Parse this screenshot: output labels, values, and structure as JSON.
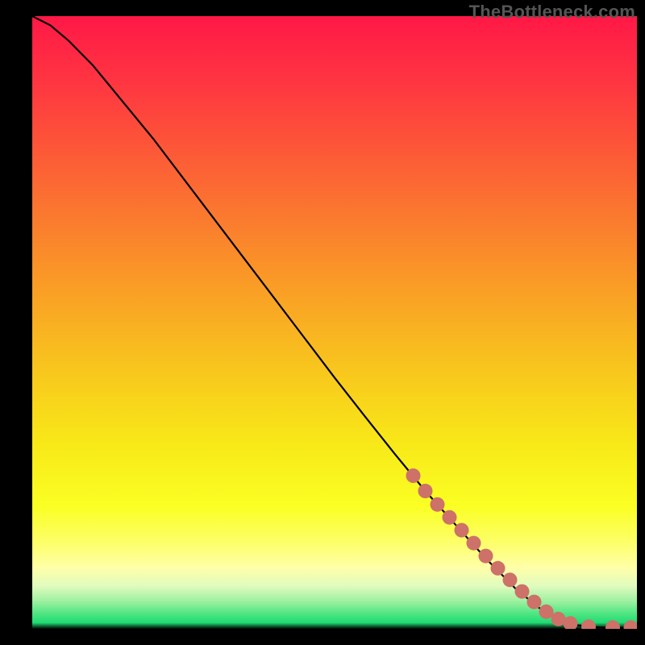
{
  "watermark": "TheBottleneck.com",
  "colors": {
    "background": "#000000",
    "curve": "#000000",
    "marker": "#cd7169",
    "gradient_stops": [
      {
        "offset": 0.0,
        "color": "#ff1846"
      },
      {
        "offset": 0.1,
        "color": "#ff3342"
      },
      {
        "offset": 0.2,
        "color": "#fd5239"
      },
      {
        "offset": 0.3,
        "color": "#fb7131"
      },
      {
        "offset": 0.4,
        "color": "#fa9029"
      },
      {
        "offset": 0.5,
        "color": "#f9af22"
      },
      {
        "offset": 0.6,
        "color": "#f8cd1c"
      },
      {
        "offset": 0.7,
        "color": "#f8e918"
      },
      {
        "offset": 0.8,
        "color": "#faff23"
      },
      {
        "offset": 0.86,
        "color": "#fdff6a"
      },
      {
        "offset": 0.9,
        "color": "#ffffa8"
      },
      {
        "offset": 0.93,
        "color": "#e0fbbe"
      },
      {
        "offset": 0.955,
        "color": "#9df1a0"
      },
      {
        "offset": 0.975,
        "color": "#50e583"
      },
      {
        "offset": 0.99,
        "color": "#1fdc73"
      },
      {
        "offset": 1.0,
        "color": "#000000"
      }
    ]
  },
  "chart_data": {
    "type": "line",
    "title": "",
    "xlabel": "",
    "ylabel": "",
    "xlim": [
      0,
      100
    ],
    "ylim": [
      0,
      100
    ],
    "series": [
      {
        "name": "bottleneck-curve",
        "x": [
          0,
          3,
          6,
          10,
          15,
          20,
          25,
          30,
          35,
          40,
          45,
          50,
          55,
          60,
          65,
          70,
          75,
          80,
          85,
          88,
          90,
          93,
          95,
          97,
          99,
          100
        ],
        "y": [
          100,
          98.5,
          96,
          92,
          86,
          80,
          73.5,
          67,
          60.5,
          54,
          47.5,
          41,
          34.7,
          28.5,
          22.5,
          17,
          11.5,
          6.5,
          2.5,
          1.2,
          0.6,
          0.3,
          0.2,
          0.2,
          0.2,
          0.2
        ]
      }
    ],
    "markers": {
      "name": "highlighted-segment",
      "x": [
        63,
        65,
        67,
        69,
        71,
        73,
        75,
        77,
        79,
        81,
        83,
        85,
        87,
        89,
        92,
        96,
        99
      ],
      "y": [
        25,
        22.5,
        20.3,
        18.2,
        16.1,
        14.0,
        11.9,
        9.9,
        8.0,
        6.1,
        4.4,
        2.8,
        1.6,
        0.9,
        0.35,
        0.22,
        0.22
      ]
    }
  }
}
